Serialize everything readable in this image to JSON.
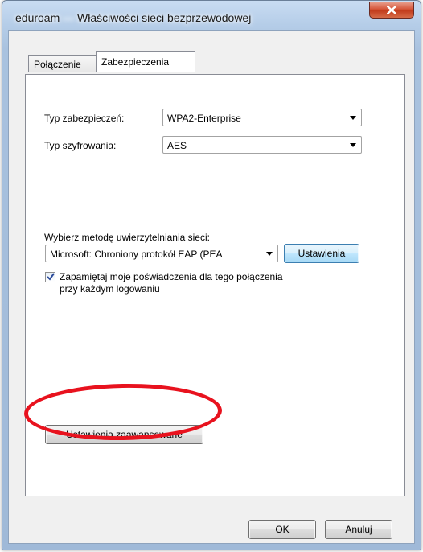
{
  "window": {
    "title": "eduroam — Właściwości sieci bezprzewodowej"
  },
  "tabs": [
    {
      "label": "Połączenie",
      "active": false
    },
    {
      "label": "Zabezpieczenia",
      "active": true
    }
  ],
  "security": {
    "type_label": "Typ zabezpieczeń:",
    "type_value": "WPA2-Enterprise",
    "encryption_label": "Typ szyfrowania:",
    "encryption_value": "AES",
    "method_label": "Wybierz metodę uwierzytelniania sieci:",
    "method_value": "Microsoft: Chroniony protokół EAP (PEA",
    "settings_button": "Ustawienia",
    "remember_line1": "Zapamiętaj moje poświadczenia dla tego połączenia",
    "remember_line2": "przy każdym logowaniu",
    "remember_checked": true,
    "advanced_button": "Ustawienia zaawansowane"
  },
  "footer": {
    "ok_label": "OK",
    "cancel_label": "Anuluj"
  },
  "colors": {
    "highlight_ellipse": "#e8121e",
    "close_button": "#c23b1c"
  },
  "icons": {
    "close": "close-icon",
    "check": "check-icon",
    "dropdown": "chevron-down-icon"
  }
}
